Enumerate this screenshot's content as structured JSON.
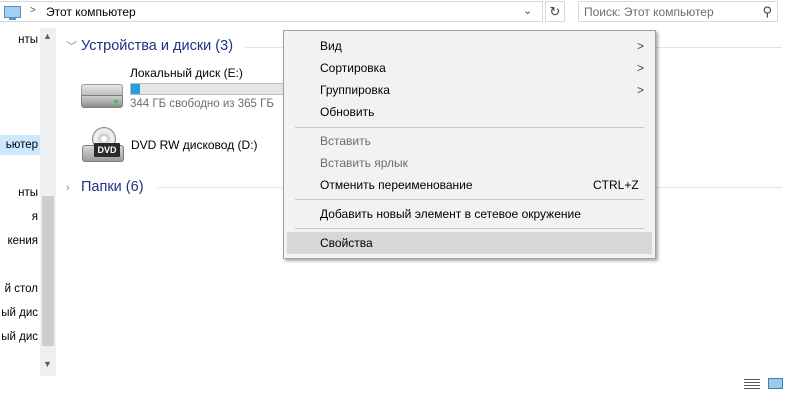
{
  "address": {
    "path": "Этот компьютер",
    "separator": ">",
    "dropdown_icon": "chevron-down-icon",
    "refresh_icon": "refresh-icon"
  },
  "search": {
    "placeholder": "Поиск: Этот компьютер",
    "icon": "search-icon"
  },
  "nav": {
    "items": [
      "нты",
      "",
      "",
      "",
      "ьютер",
      "",
      "нты",
      "я",
      "кения",
      "",
      "й стол",
      "ый дис",
      "ый дис"
    ],
    "selected_index": 4
  },
  "groups": {
    "devices": {
      "label": "Устройства и диски (3)",
      "expanded": true
    },
    "folders": {
      "label": "Папки (6)",
      "expanded": false
    }
  },
  "drives": {
    "local": {
      "name": "Локальный диск (E:)",
      "info": "344 ГБ свободно из 365 ГБ",
      "used_fraction": 0.06
    },
    "dvd": {
      "name": "DVD RW дисковод (D:)",
      "badge": "DVD"
    }
  },
  "context_menu": {
    "view": "Вид",
    "sort": "Сортировка",
    "group": "Группировка",
    "refresh": "Обновить",
    "paste": "Вставить",
    "paste_shortcut": "Вставить ярлык",
    "undo_rename": "Отменить переименование",
    "undo_shortcut": "CTRL+Z",
    "add_network": "Добавить новый элемент в сетевое окружение",
    "properties": "Свойства",
    "submenu_arrow": ">"
  },
  "colors": {
    "group_header": "#1e3287",
    "drive_fill": "#26a0da",
    "menu_bg": "#f2f2f2",
    "menu_hover": "#d7d7d7"
  }
}
